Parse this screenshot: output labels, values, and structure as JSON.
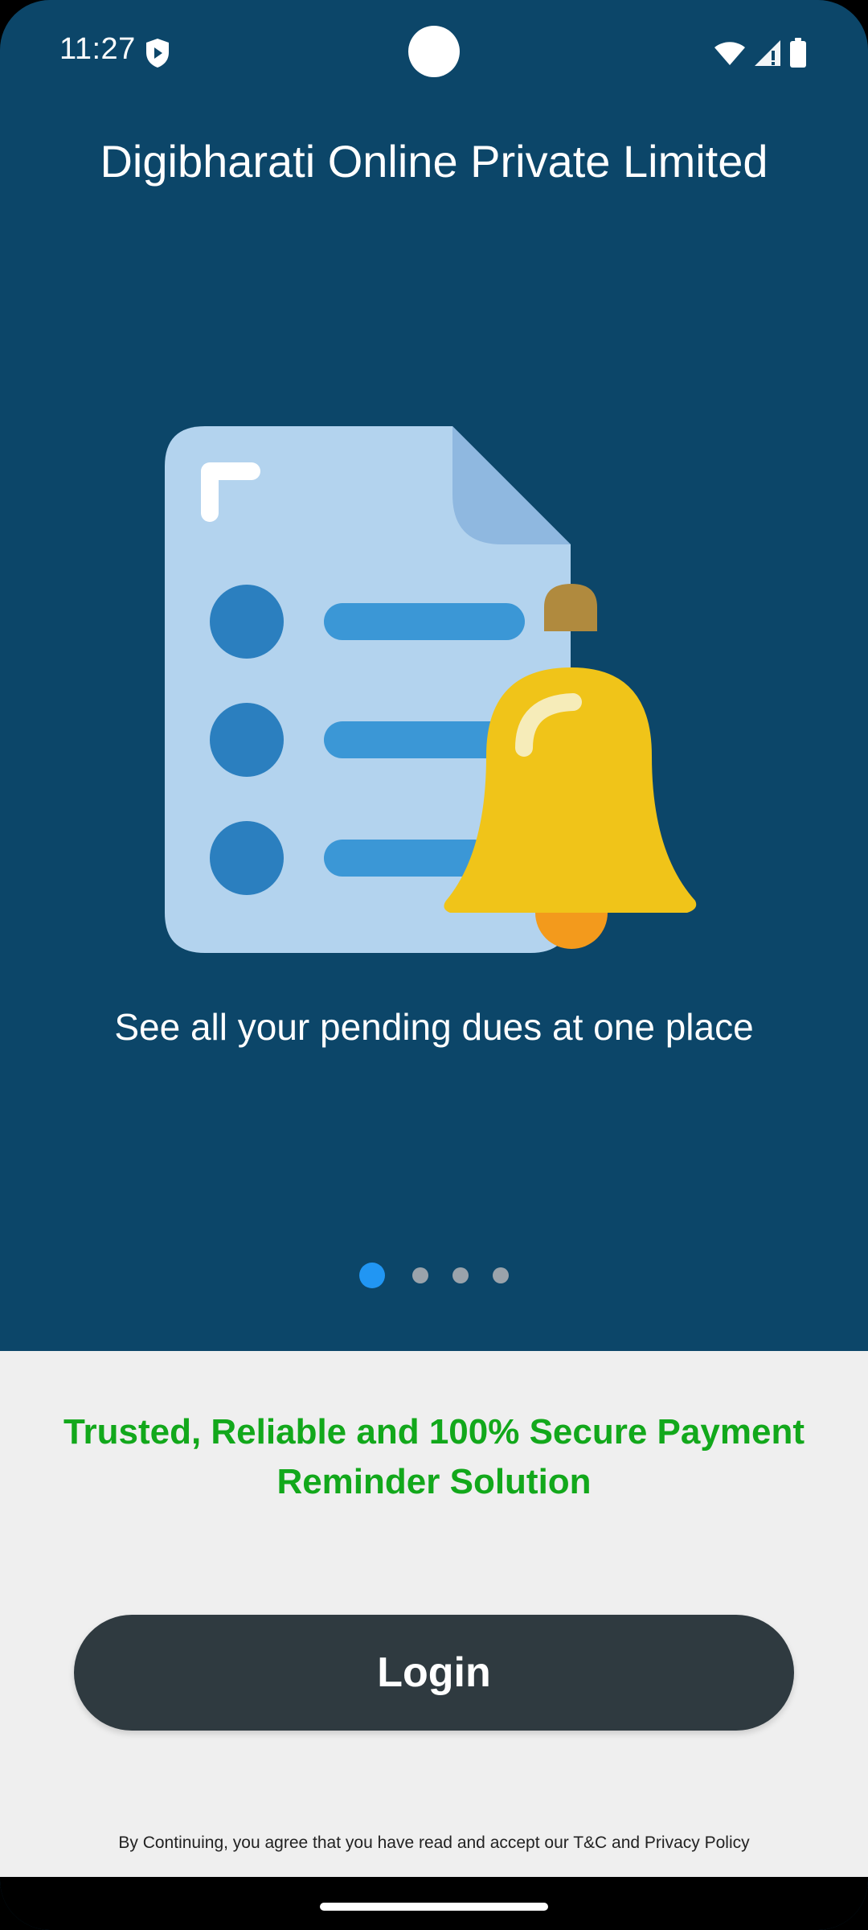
{
  "status_bar": {
    "time": "11:27",
    "icons": [
      "shield-icon",
      "wifi-icon",
      "signal-icon",
      "battery-icon"
    ]
  },
  "onboarding": {
    "company_title": "Digibharati Online Private Limited",
    "illustration": "document-bell-illustration",
    "caption": "See all your pending dues at one place",
    "pager": {
      "total_pages": 4,
      "active_page": 1
    }
  },
  "bottom": {
    "tagline": "Trusted, Reliable and 100% Secure Payment Reminder Solution",
    "login_label": "Login",
    "disclaimer": "By Continuing, you agree that you have read and accept our T&C and Privacy Policy"
  },
  "colors": {
    "primary_background": "#0c4669",
    "bottom_background": "#efefef",
    "tagline_green": "#12a81b",
    "login_button": "#2f3a40",
    "pager_active": "#2196f3",
    "pager_inactive": "#9aa3ab"
  }
}
